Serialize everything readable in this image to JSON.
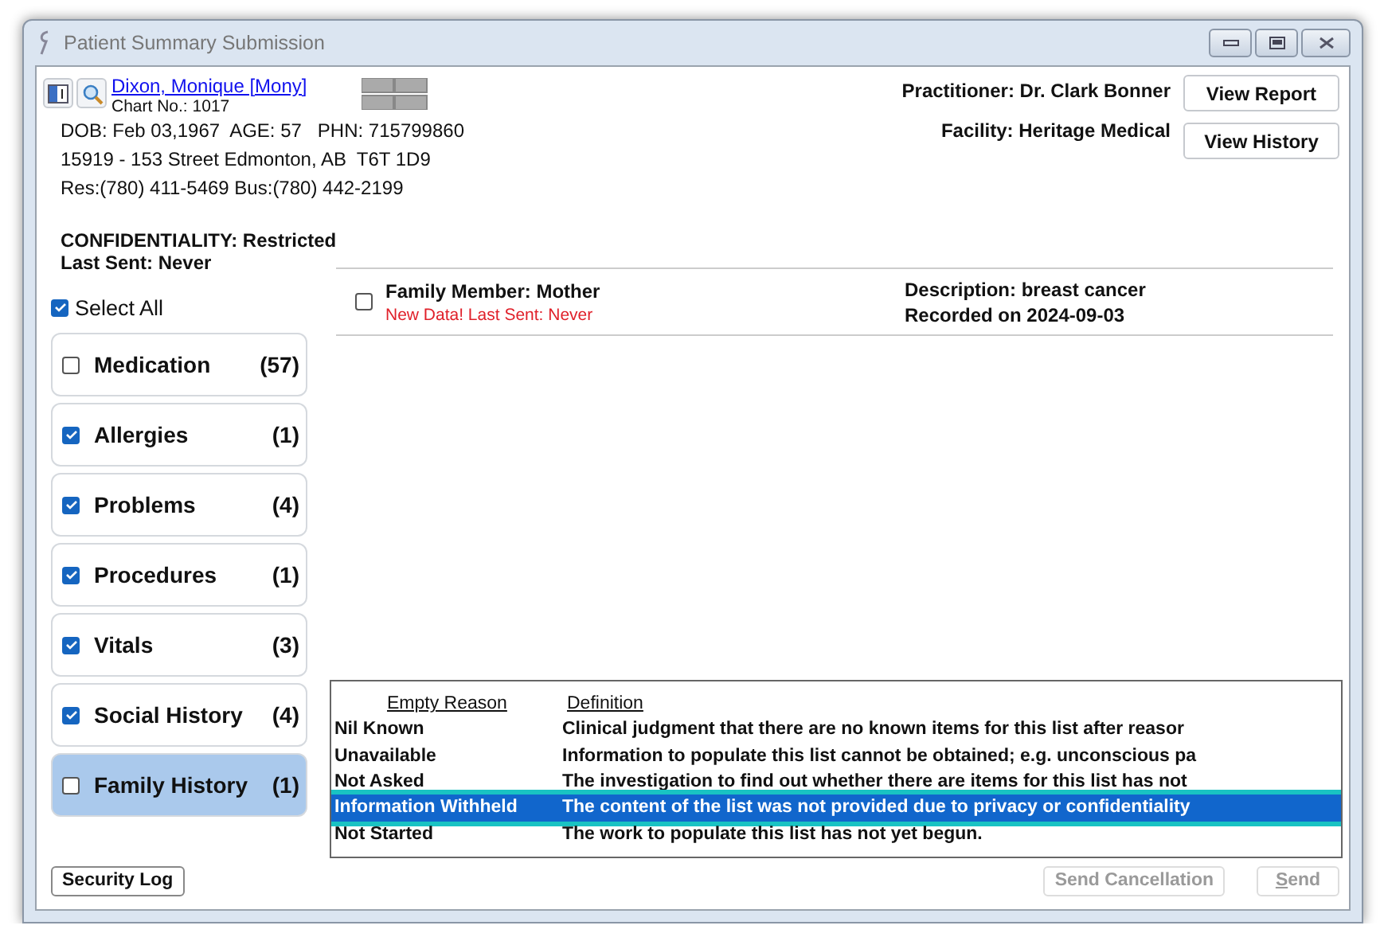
{
  "window": {
    "title": "Patient Summary Submission"
  },
  "patient": {
    "name": "Dixon, Monique [Mony]",
    "chart_no": "Chart No.: 1017",
    "lines": [
      "DOB: Feb 03,1967  AGE: 57   PHN: 715799860",
      "15919 - 153 Street Edmonton, AB  T6T 1D9",
      "Res:(780) 411-5469 Bus:(780) 442-2199"
    ],
    "confidentiality": "CONFIDENTIALITY: Restricted",
    "last_sent": "Last Sent: Never"
  },
  "practitioner": "Practitioner: Dr. Clark Bonner",
  "facility": "Facility: Heritage Medical",
  "header_buttons": [
    "View Report",
    "View History"
  ],
  "select_all": {
    "label": "Select All",
    "checked": true
  },
  "categories": [
    {
      "label": "Medication",
      "count": "(57)",
      "checked": false,
      "selected": false
    },
    {
      "label": "Allergies",
      "count": "(1)",
      "checked": true,
      "selected": false
    },
    {
      "label": "Problems",
      "count": "(4)",
      "checked": true,
      "selected": false
    },
    {
      "label": "Procedures",
      "count": "(1)",
      "checked": true,
      "selected": false
    },
    {
      "label": "Vitals",
      "count": "(3)",
      "checked": true,
      "selected": false
    },
    {
      "label": "Social History",
      "count": "(4)",
      "checked": true,
      "selected": false
    },
    {
      "label": "Family History",
      "count": "(1)",
      "checked": false,
      "selected": true
    }
  ],
  "entries": [
    {
      "title": "Family Member: Mother",
      "status": "New Data! Last Sent: Never",
      "description": "Description: breast cancer",
      "recorded": "Recorded on 2024-09-03",
      "checked": false
    }
  ],
  "empty_reasons": {
    "columns": [
      "Empty Reason",
      "Definition"
    ],
    "rows": [
      {
        "reason": "Nil Known",
        "definition": "Clinical judgment that there are no known items for this list after reasor",
        "selected": false
      },
      {
        "reason": "Unavailable",
        "definition": "Information to populate this list cannot be obtained; e.g. unconscious pa",
        "selected": false
      },
      {
        "reason": "Not Asked",
        "definition": "The investigation to find out whether there are items for this list has not",
        "selected": false
      },
      {
        "reason": "Information Withheld",
        "definition": "The content of the list was not provided due to privacy or confidentiality",
        "selected": true
      },
      {
        "reason": "Not Started",
        "definition": "The work to populate this list has not yet begun.",
        "selected": false
      }
    ]
  },
  "footer": {
    "security_log": "Security Log",
    "send_cancellation": {
      "label": "Send Cancellation",
      "disabled": true
    },
    "send": {
      "label": "Send",
      "disabled": true
    }
  }
}
